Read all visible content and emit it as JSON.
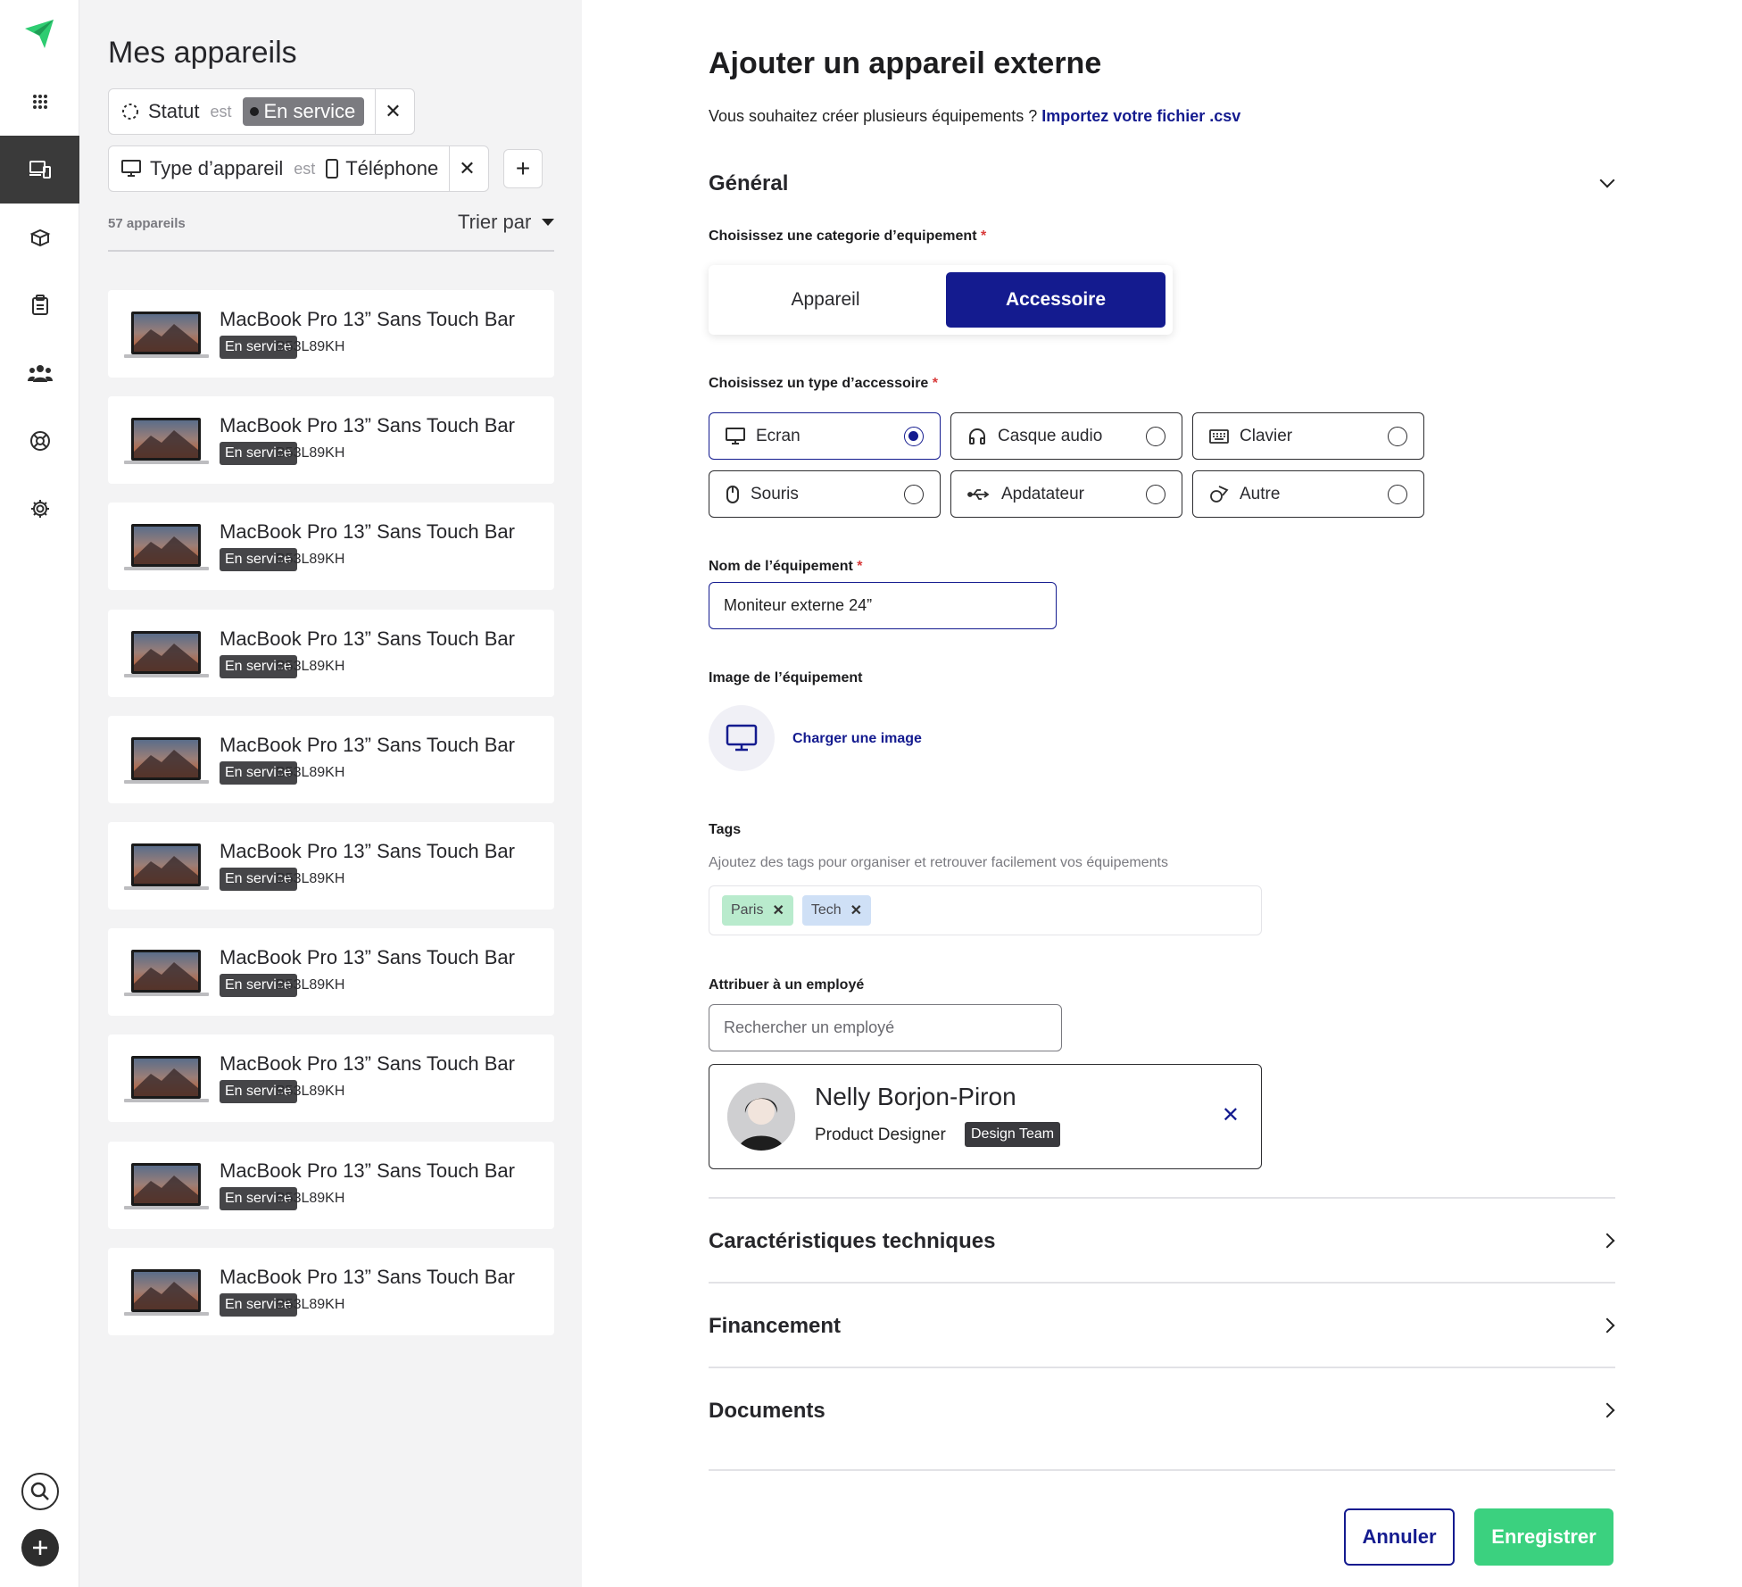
{
  "list": {
    "title": "Mes appareils",
    "filters": [
      {
        "field": "Statut",
        "operator": "est",
        "value": "En service"
      },
      {
        "field": "Type d’appareil",
        "operator": "est",
        "value": "Téléphone"
      }
    ],
    "count": "57 appareils",
    "sort_label": "Trier par",
    "devices": [
      {
        "name": "MacBook Pro 13” Sans Touch Bar",
        "status": "En service",
        "serial": "B53L89KH"
      },
      {
        "name": "MacBook Pro 13” Sans Touch Bar",
        "status": "En service",
        "serial": "B53L89KH"
      },
      {
        "name": "MacBook Pro 13” Sans Touch Bar",
        "status": "En service",
        "serial": "B53L89KH"
      },
      {
        "name": "MacBook Pro 13” Sans Touch Bar",
        "status": "En service",
        "serial": "B53L89KH"
      },
      {
        "name": "MacBook Pro 13” Sans Touch Bar",
        "status": "En service",
        "serial": "B53L89KH"
      },
      {
        "name": "MacBook Pro 13” Sans Touch Bar",
        "status": "En service",
        "serial": "B53L89KH"
      },
      {
        "name": "MacBook Pro 13” Sans Touch Bar",
        "status": "En service",
        "serial": "B53L89KH"
      },
      {
        "name": "MacBook Pro 13” Sans Touch Bar",
        "status": "En service",
        "serial": "B53L89KH"
      },
      {
        "name": "MacBook Pro 13” Sans Touch Bar",
        "status": "En service",
        "serial": "B53L89KH"
      },
      {
        "name": "MacBook Pro 13” Sans Touch Bar",
        "status": "En service",
        "serial": "B53L89KH"
      }
    ]
  },
  "form": {
    "title": "Ajouter un appareil externe",
    "subtitle": "Vous souhaitez créer plusieurs équipements ?",
    "import_link": "Importez votre fichier .csv",
    "general_title": "Général",
    "category_label": "Choisissez une categorie d’equipement",
    "category_options": [
      "Appareil",
      "Accessoire"
    ],
    "category_selected": "Accessoire",
    "type_label": "Choisissez un type d’accessoire",
    "types": [
      "Ecran",
      "Casque audio",
      "Clavier",
      "Souris",
      "Apdatateur",
      "Autre"
    ],
    "type_selected": "Ecran",
    "name_label": "Nom de l’équipement",
    "name_value": "Moniteur externe 24”",
    "image_label": "Image de l’équipement",
    "upload_label": "Charger une image",
    "tags_label": "Tags",
    "tags_hint": "Ajoutez des tags pour organiser et retrouver facilement vos équipements",
    "tags": [
      "Paris",
      "Tech"
    ],
    "assign_label": "Attribuer à un employé",
    "assign_placeholder": "Rechercher un employé",
    "employee": {
      "name": "Nelly Borjon-Piron",
      "role": "Product Designer",
      "team": "Design Team"
    },
    "sections": [
      "Caractéristiques techniques",
      "Financement",
      "Documents"
    ],
    "cancel_label": "Annuler",
    "save_label": "Enregistrer"
  },
  "colors": {
    "accent": "#141b8f",
    "success": "#3bd17f",
    "brand": "#2ecc71"
  }
}
